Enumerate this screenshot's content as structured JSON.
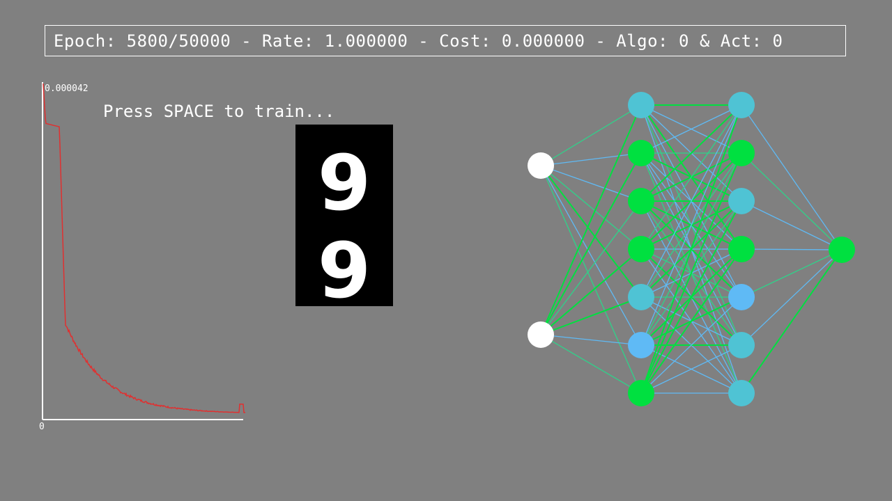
{
  "status": {
    "text": "Epoch: 5800/50000 - Rate: 1.000000 - Cost: 0.000000 - Algo: 0 & Act: 0",
    "epoch": 5800,
    "epochs_total": 50000,
    "rate": "1.000000",
    "cost": "0.000000",
    "algo": 0,
    "act": 0
  },
  "hint": {
    "text": "Press SPACE to train..."
  },
  "cost_plot": {
    "max_label": "0.000042",
    "zero_label": "0",
    "line_color": "#e03030",
    "axis_color": "#ffffff"
  },
  "digits": {
    "samples": [
      "9",
      "9"
    ],
    "fg_color": "#ffffff",
    "bg_color": "#000000"
  },
  "network": {
    "layers": [
      2,
      7,
      7,
      1
    ],
    "node_colors": {
      "input": "#ffffff",
      "cyan": "#4fc3d4",
      "green": "#00e040",
      "blue": "#5fbaf5"
    },
    "layer_node_colors": [
      [
        "input",
        "input"
      ],
      [
        "cyan",
        "green",
        "green",
        "green",
        "cyan",
        "blue",
        "green"
      ],
      [
        "cyan",
        "green",
        "cyan",
        "green",
        "blue",
        "cyan",
        "cyan"
      ],
      [
        "green"
      ]
    ],
    "edge_colors": {
      "positive": "#00e040",
      "negative": "#5fbaf5",
      "mixed": "#2ed38a"
    }
  }
}
